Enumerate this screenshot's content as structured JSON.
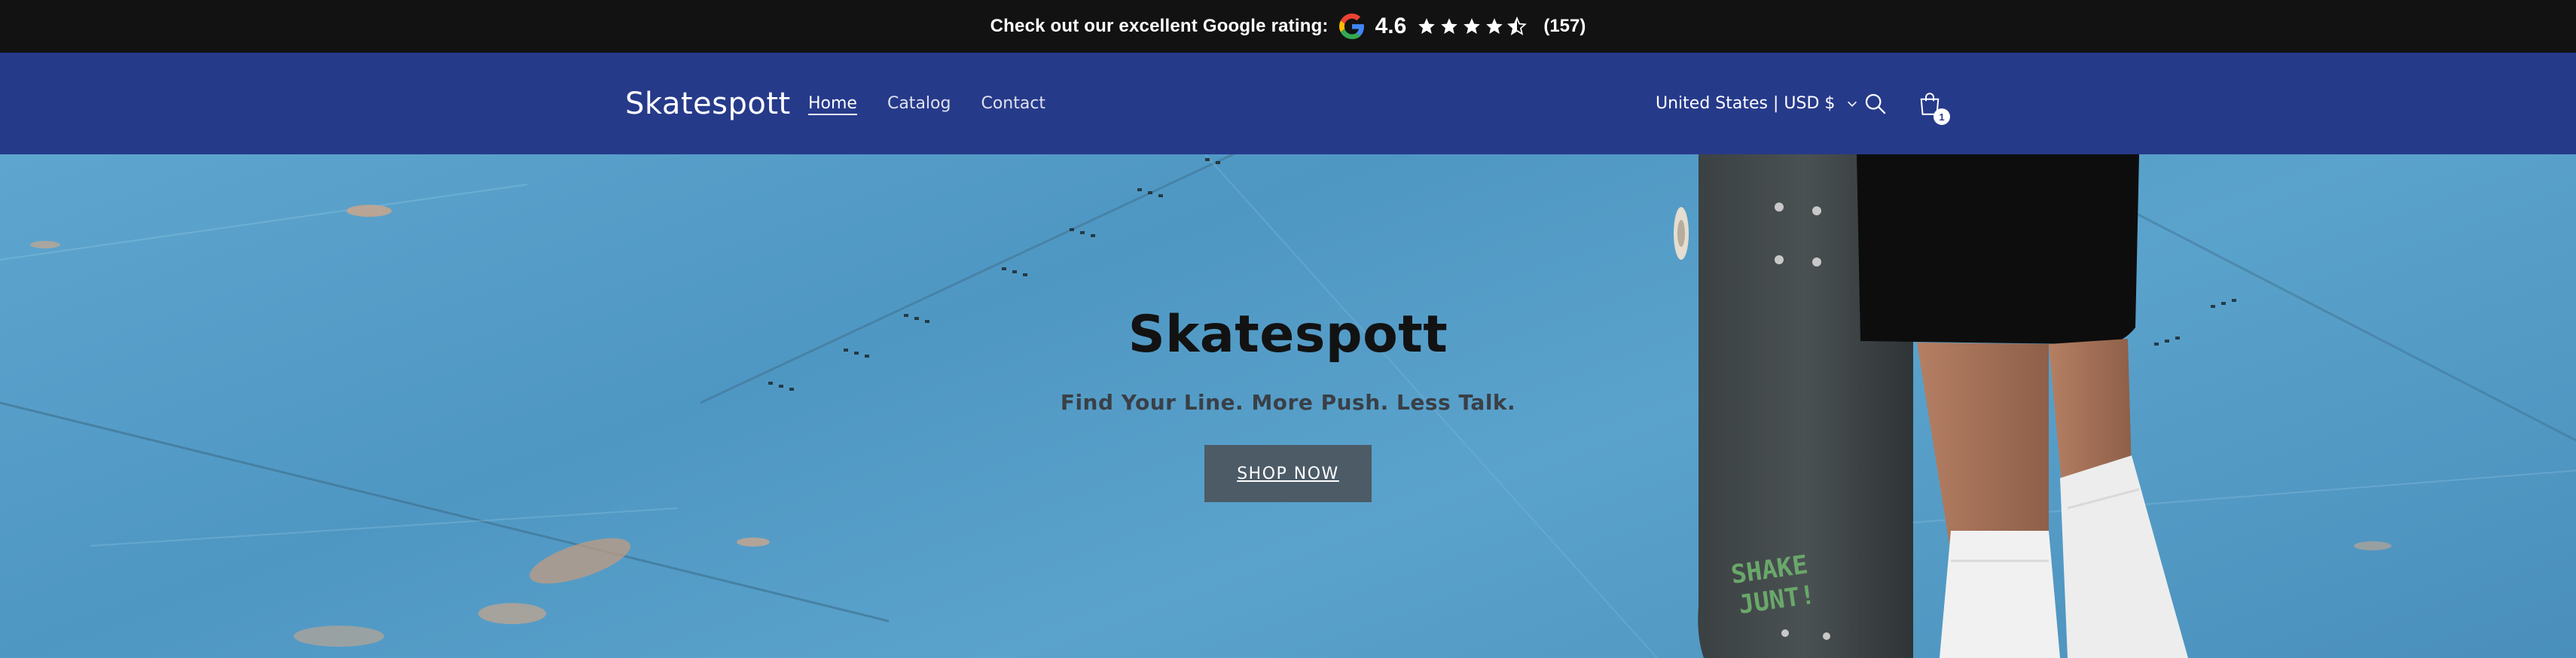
{
  "announcement": {
    "text": "Check out our excellent Google rating:",
    "google_icon": "google-g-icon",
    "score": "4.6",
    "stars": [
      {
        "icon": "star-full-icon"
      },
      {
        "icon": "star-full-icon"
      },
      {
        "icon": "star-full-icon"
      },
      {
        "icon": "star-full-icon"
      },
      {
        "icon": "star-half-icon"
      }
    ],
    "count": "(157)",
    "background": "#121212"
  },
  "header": {
    "logo": "Skatespott",
    "background": "#263a8a",
    "nav": [
      {
        "label": "Home",
        "active": true
      },
      {
        "label": "Catalog",
        "active": false
      },
      {
        "label": "Contact",
        "active": false
      }
    ],
    "country_selector": "United States | USD $",
    "search_icon": "search-icon",
    "cart_icon": "cart-icon",
    "cart_count": "1"
  },
  "hero": {
    "title": "Skatespott",
    "subtitle": "Find Your Line. More Push. Less Talk.",
    "button_label": "SHOP NOW",
    "button_color": "#4c5b66"
  }
}
